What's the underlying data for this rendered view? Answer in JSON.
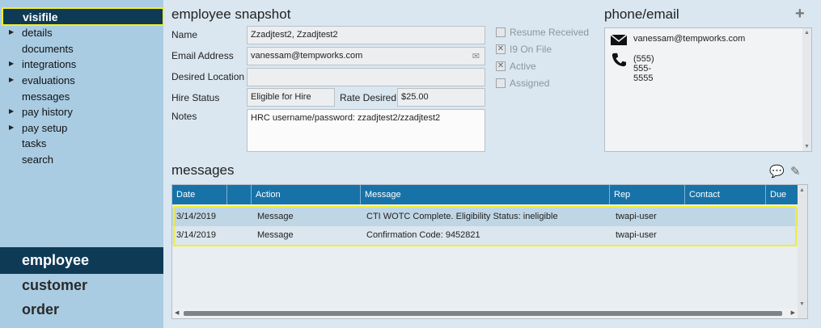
{
  "sidebar": {
    "active_item": "visifile",
    "items": [
      {
        "label": "details",
        "arrow": true
      },
      {
        "label": "documents",
        "arrow": false
      },
      {
        "label": "integrations",
        "arrow": true
      },
      {
        "label": "evaluations",
        "arrow": true
      },
      {
        "label": "messages",
        "arrow": false
      },
      {
        "label": "pay history",
        "arrow": true
      },
      {
        "label": "pay setup",
        "arrow": true
      },
      {
        "label": "tasks",
        "arrow": false
      },
      {
        "label": "search",
        "arrow": false
      }
    ],
    "modules": {
      "active": "employee",
      "customer": "customer",
      "order": "order"
    }
  },
  "snapshot": {
    "title": "employee snapshot",
    "name_label": "Name",
    "name_value": "Zzadjtest2, Zzadjtest2",
    "email_label": "Email Address",
    "email_value": "vanessam@tempworks.com",
    "location_label": "Desired Location",
    "location_value": "",
    "hire_label": "Hire Status",
    "hire_value": "Eligible for Hire",
    "rate_label": "Rate Desired",
    "rate_value": "$25.00",
    "notes_label": "Notes",
    "notes_value": "HRC username/password: zzadjtest2/zzadjtest2"
  },
  "checks": [
    {
      "label": "Resume Received",
      "checked": false
    },
    {
      "label": "I9 On File",
      "checked": true
    },
    {
      "label": "Active",
      "checked": true
    },
    {
      "label": "Assigned",
      "checked": false
    }
  ],
  "phone_email": {
    "title": "phone/email",
    "email": "vanessam@tempworks.com",
    "phone": "(555) 555-5555"
  },
  "messages": {
    "title": "messages",
    "columns": {
      "date": "Date",
      "blank": "",
      "action": "Action",
      "message": "Message",
      "rep": "Rep",
      "contact": "Contact",
      "due": "Due"
    },
    "rows": [
      {
        "date": "3/14/2019",
        "action": "Message",
        "message": "CTI WOTC Complete. Eligibility Status: ineligible",
        "rep": "twapi-user",
        "contact": "",
        "due": ""
      },
      {
        "date": "3/14/2019",
        "action": "Message",
        "message": "Confirmation Code: 9452821",
        "rep": "twapi-user",
        "contact": "",
        "due": ""
      }
    ]
  },
  "colors": {
    "sidebar": "#a9cce3",
    "active": "#0f3a56",
    "grid_header": "#1772a8",
    "highlight": "#f2ee2a"
  }
}
